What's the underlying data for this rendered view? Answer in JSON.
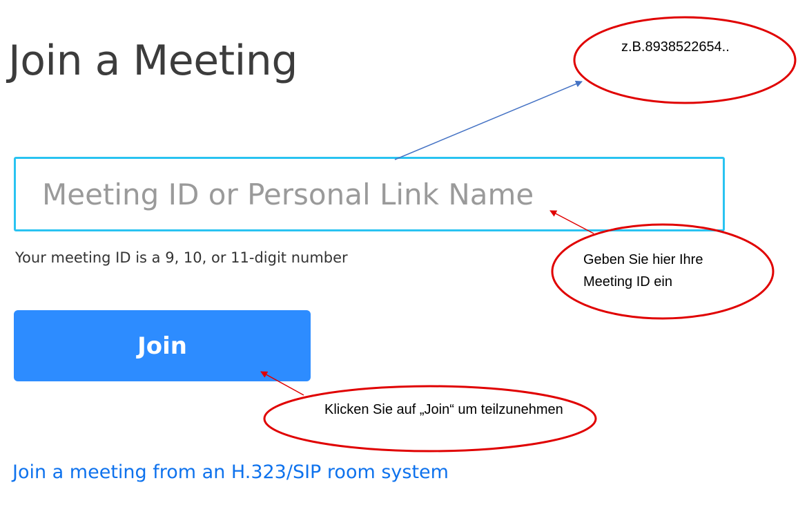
{
  "page": {
    "title": "Join a Meeting"
  },
  "form": {
    "meeting_id_value": "",
    "meeting_id_placeholder": "Meeting ID or Personal Link Name",
    "hint": "Your meeting ID is a 9, 10, or 11-digit number",
    "join_label": "Join",
    "room_system_link": "Join a meeting from an H.323/SIP room system"
  },
  "annotations": {
    "example_id": "z.B.8938522654..",
    "enter_id_note": "Geben Sie hier Ihre Meeting ID ein",
    "click_join_note": "Klicken Sie auf „Join“ um teilzunehmen"
  },
  "colors": {
    "accent": "#2d8cff",
    "input_border": "#29c3f1",
    "link": "#0e72ed",
    "annotation_red": "#e00000",
    "annotation_blue": "#4472c4"
  }
}
